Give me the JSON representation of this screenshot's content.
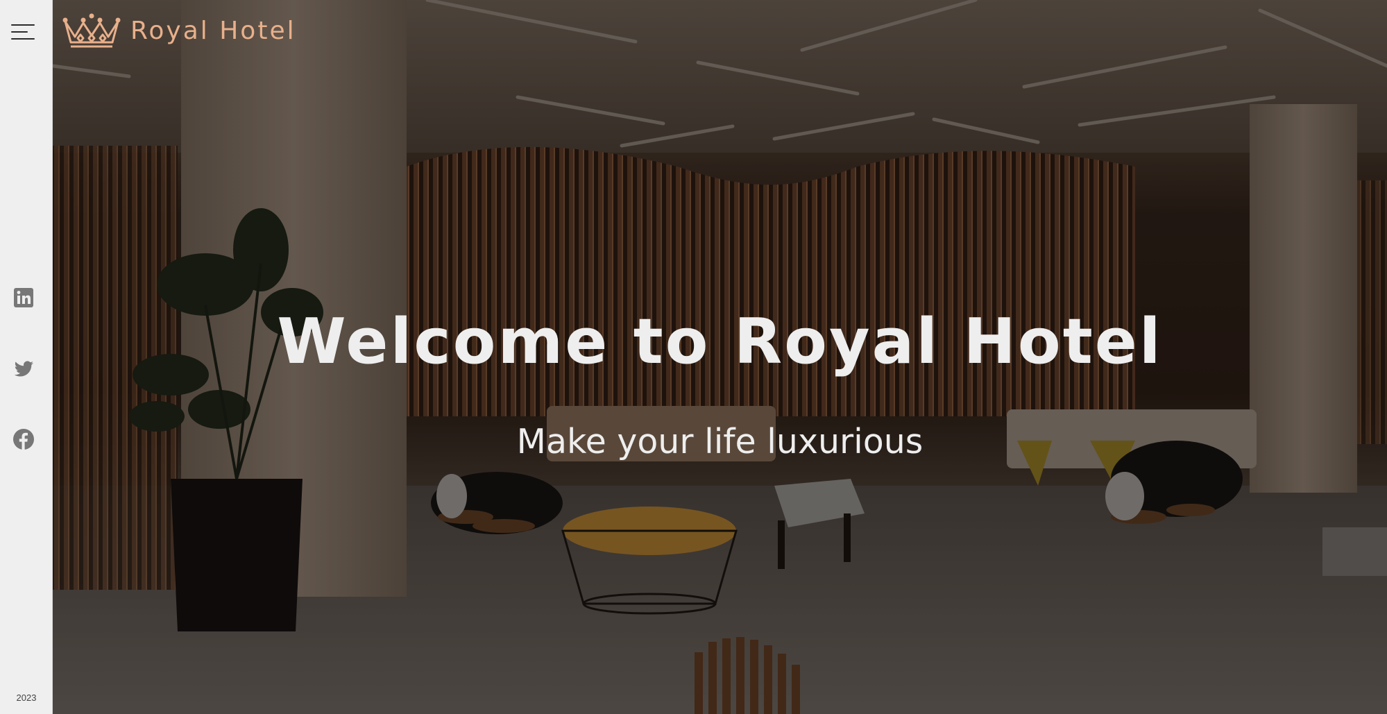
{
  "brand": {
    "name": "Royal Hotel",
    "logo_icon": "crown-icon",
    "color": "#e8b08b"
  },
  "sidebar": {
    "menu_icon": "hamburger-menu-icon",
    "social": [
      {
        "name": "LinkedIn",
        "icon": "linkedin-icon"
      },
      {
        "name": "Twitter",
        "icon": "twitter-icon"
      },
      {
        "name": "Facebook",
        "icon": "facebook-icon"
      }
    ],
    "year": "2023",
    "background": "#efefef"
  },
  "hero": {
    "title": "Welcome to Royal Hotel",
    "subtitle": "Make your life luxurious",
    "text_color": "#eeeeee",
    "background_image": "hotel-lobby-photo"
  }
}
